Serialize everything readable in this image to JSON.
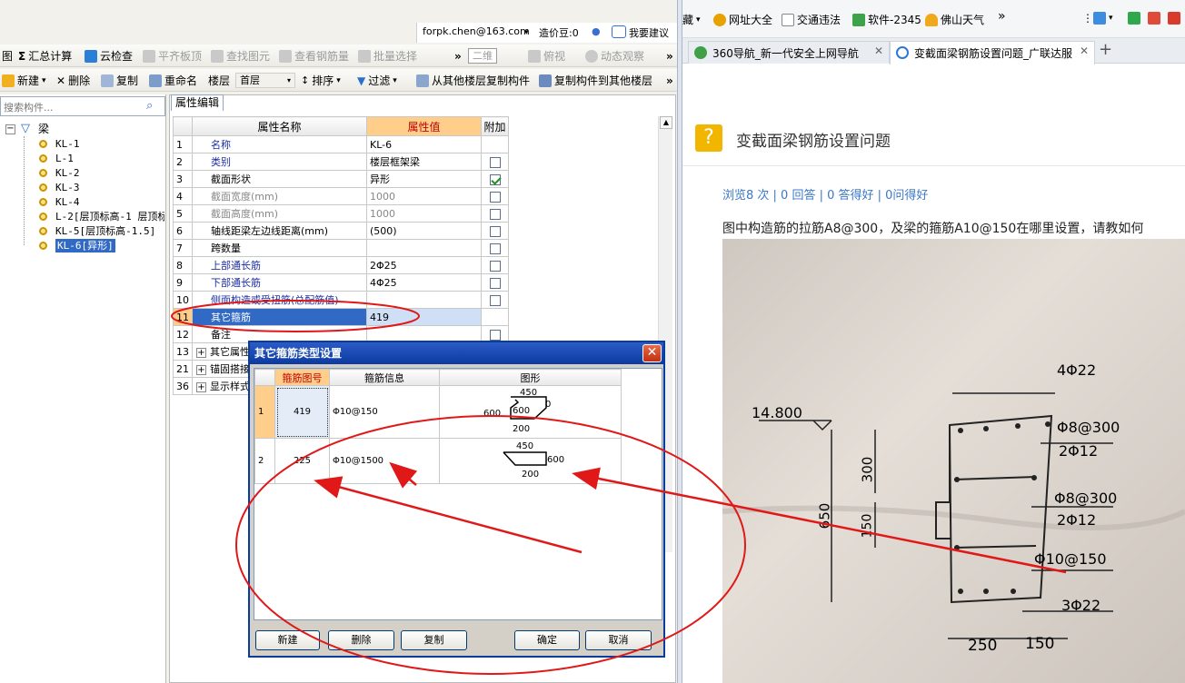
{
  "account": {
    "email": "forpk.chen@163.com",
    "price_beans": "造价豆:0",
    "feedback": "我要建议"
  },
  "toolbar1": {
    "partial_fig": "图",
    "summary_calc": "汇总计算",
    "cloud_check": "云检查",
    "flat_slab": "平齐板顶",
    "find_elem": "查找图元",
    "view_rebar": "查看钢筋量",
    "batch_select": "批量选择",
    "view_2d": "二维",
    "top_view": "俯视",
    "dynamic_view": "动态观察"
  },
  "toolbar2": {
    "new": "新建",
    "delete": "删除",
    "copy": "复制",
    "rename": "重命名",
    "floor_label": "楼层",
    "floor_value": "首层",
    "sort": "排序",
    "filter": "过滤",
    "copy_from_floor": "从其他楼层复制构件",
    "copy_to_floor": "复制构件到其他楼层"
  },
  "tree": {
    "search_placeholder": "搜索构件...",
    "root": "梁",
    "items": [
      "KL-1",
      "L-1",
      "KL-2",
      "KL-3",
      "KL-4",
      "L-2[层顶标高-1 层顶标",
      "KL-5[层顶标高-1.5]",
      "KL-6[异形]"
    ]
  },
  "props": {
    "tab": "属性编辑",
    "col_name": "属性名称",
    "col_value": "属性值",
    "col_extra": "附加",
    "rows": [
      {
        "no": "1",
        "name": "名称",
        "value": "KL-6"
      },
      {
        "no": "2",
        "name": "类别",
        "value": "楼层框架梁"
      },
      {
        "no": "3",
        "name": "截面形状",
        "value": "异形"
      },
      {
        "no": "4",
        "name": "截面宽度(mm)",
        "value": "1000"
      },
      {
        "no": "5",
        "name": "截面高度(mm)",
        "value": "1000"
      },
      {
        "no": "6",
        "name": "轴线距梁左边线距离(mm)",
        "value": "(500)"
      },
      {
        "no": "7",
        "name": "跨数量",
        "value": ""
      },
      {
        "no": "8",
        "name": "上部通长筋",
        "value": "2Φ25"
      },
      {
        "no": "9",
        "name": "下部通长筋",
        "value": "4Φ25"
      },
      {
        "no": "10",
        "name": "侧面构造或受扭筋(总配筋值)",
        "value": ""
      },
      {
        "no": "11",
        "name": "其它箍筋",
        "value": "419"
      },
      {
        "no": "12",
        "name": "备注",
        "value": ""
      },
      {
        "no": "13",
        "name": "其它属性",
        "value": ""
      },
      {
        "no": "21",
        "name": "锚固搭接",
        "value": ""
      },
      {
        "no": "36",
        "name": "显示样式",
        "value": ""
      }
    ]
  },
  "dialog": {
    "title": "其它箍筋类型设置",
    "col_fig": "箍筋图号",
    "col_info": "箍筋信息",
    "col_shape": "图形",
    "rows": [
      {
        "no": "1",
        "fig": "419",
        "info": "Φ10@150",
        "dims": [
          "450",
          "600",
          "0",
          "600",
          "200"
        ]
      },
      {
        "no": "2",
        "fig": "225",
        "info": "Φ10@1500",
        "dims": [
          "450",
          "600",
          "200"
        ]
      }
    ],
    "btn_new": "新建",
    "btn_delete": "删除",
    "btn_copy": "复制",
    "btn_ok": "确定",
    "btn_cancel": "取消"
  },
  "browser": {
    "bookmarks": [
      "藏",
      "网址大全",
      "交通违法",
      "软件-2345",
      "佛山天气"
    ],
    "tabs": [
      {
        "label": "360导航_新一代安全上网导航"
      },
      {
        "label": "变截面梁钢筋设置问题_广联达服"
      }
    ],
    "question_title": "变截面梁钢筋设置问题",
    "stats": "浏览8 次 | 0 回答 | 0 答得好 | 0问得好",
    "question_text": "图中构造筋的拉筋A8@300，及梁的箍筋A10@150在哪里设置，请教如何",
    "sketch_labels": {
      "top_bars": "4Φ22",
      "elev": "14.800",
      "rebar1": "Φ8@300",
      "rebar2": "2Φ12",
      "rebar3": "Φ8@300",
      "rebar4": "2Φ12",
      "stirrup": "Φ10@150",
      "bottom_bars": "3Φ22",
      "h300": "300",
      "h650": "650",
      "h150": "150",
      "w250": "250",
      "w150": "150"
    }
  }
}
